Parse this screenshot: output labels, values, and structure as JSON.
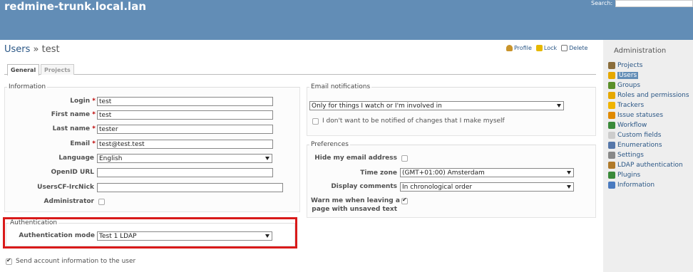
{
  "header": {
    "site_title": "redmine-trunk.local.lan",
    "search_label": "Search:"
  },
  "page": {
    "title_link": "Users",
    "title_sep": " » ",
    "title_current": "test"
  },
  "actions": {
    "profile": "Profile",
    "lock": "Lock",
    "delete": "Delete"
  },
  "tabs": {
    "general": "General",
    "projects": "Projects"
  },
  "information": {
    "legend": "Information",
    "login": {
      "label": "Login",
      "value": "test"
    },
    "firstname": {
      "label": "First name",
      "value": "test"
    },
    "lastname": {
      "label": "Last name",
      "value": "tester"
    },
    "email": {
      "label": "Email",
      "value": "test@test.test"
    },
    "language": {
      "label": "Language",
      "value": "English"
    },
    "openid": {
      "label": "OpenID URL",
      "value": ""
    },
    "ircnick": {
      "label": "UsersCF-IrcNick",
      "value": ""
    },
    "admin": {
      "label": "Administrator",
      "checked": false
    },
    "required_mark": "*"
  },
  "authentication": {
    "legend": "Authentication",
    "mode_label": "Authentication mode",
    "mode_value": "Test 1 LDAP"
  },
  "send_info": {
    "label": "Send account information to the user",
    "checked": true
  },
  "email_notifications": {
    "legend": "Email notifications",
    "select_value": "Only for things I watch or I'm involved in",
    "no_self_notified": "I don't want to be notified of changes that I make myself"
  },
  "preferences": {
    "legend": "Preferences",
    "hide_mail": "Hide my email address",
    "time_zone_label": "Time zone",
    "time_zone_value": "(GMT+01:00) Amsterdam",
    "comments_label": "Display comments",
    "comments_value": "In chronological order",
    "warn_line1": "Warn me when leaving a",
    "warn_line2": "page with unsaved text"
  },
  "sidebar": {
    "title": "Administration",
    "items": [
      {
        "label": "Projects",
        "icon": "projects-icon",
        "color": "#8a6d3b"
      },
      {
        "label": "Users",
        "icon": "users-icon",
        "color": "#e6a800"
      },
      {
        "label": "Groups",
        "icon": "groups-icon",
        "color": "#5a8f29"
      },
      {
        "label": "Roles and permissions",
        "icon": "roles-icon",
        "color": "#e6a800"
      },
      {
        "label": "Trackers",
        "icon": "trackers-icon",
        "color": "#f0b400"
      },
      {
        "label": "Issue statuses",
        "icon": "statuses-icon",
        "color": "#e08a00"
      },
      {
        "label": "Workflow",
        "icon": "workflow-icon",
        "color": "#3a8a3a"
      },
      {
        "label": "Custom fields",
        "icon": "custom-fields-icon",
        "color": "#cccccc"
      },
      {
        "label": "Enumerations",
        "icon": "enumerations-icon",
        "color": "#5577aa"
      },
      {
        "label": "Settings",
        "icon": "settings-icon",
        "color": "#888888"
      },
      {
        "label": "LDAP authentication",
        "icon": "ldap-icon",
        "color": "#b07a2a"
      },
      {
        "label": "Plugins",
        "icon": "plugins-icon",
        "color": "#3a8a3a"
      },
      {
        "label": "Information",
        "icon": "information-icon",
        "color": "#4a7bc0"
      }
    ]
  }
}
